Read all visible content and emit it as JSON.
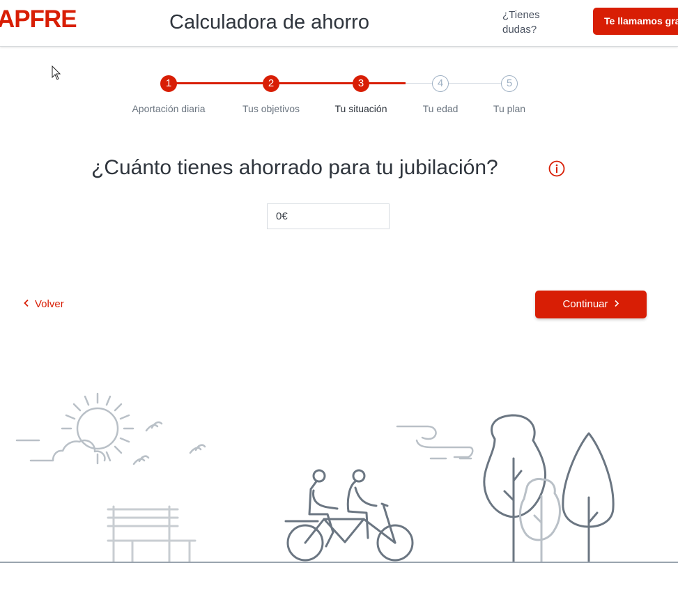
{
  "header": {
    "logo": "APFRE",
    "title": "Calculadora de ahorro",
    "help_text": "¿Tienes dudas?",
    "call_button": "Te llamamos gra"
  },
  "stepper": {
    "steps": [
      {
        "number": "1",
        "label": "Aportación diaria",
        "state": "done"
      },
      {
        "number": "2",
        "label": "Tus objetivos",
        "state": "done"
      },
      {
        "number": "3",
        "label": "Tu situación",
        "state": "current"
      },
      {
        "number": "4",
        "label": "Tu edad",
        "state": "todo"
      },
      {
        "number": "5",
        "label": "Tu plan",
        "state": "todo"
      }
    ]
  },
  "main": {
    "question": "¿Cuánto tienes ahorrado para tu jubilación?",
    "info_icon": "info-icon",
    "savings_input": {
      "value": "",
      "placeholder": "0€"
    }
  },
  "nav": {
    "back_label": "Volver",
    "continue_label": "Continuar"
  },
  "colors": {
    "accent": "#d81e05",
    "text_dark": "#2f353d",
    "step_todo": "#9fb1c4",
    "illustration_stroke": "#b9c0c7"
  }
}
